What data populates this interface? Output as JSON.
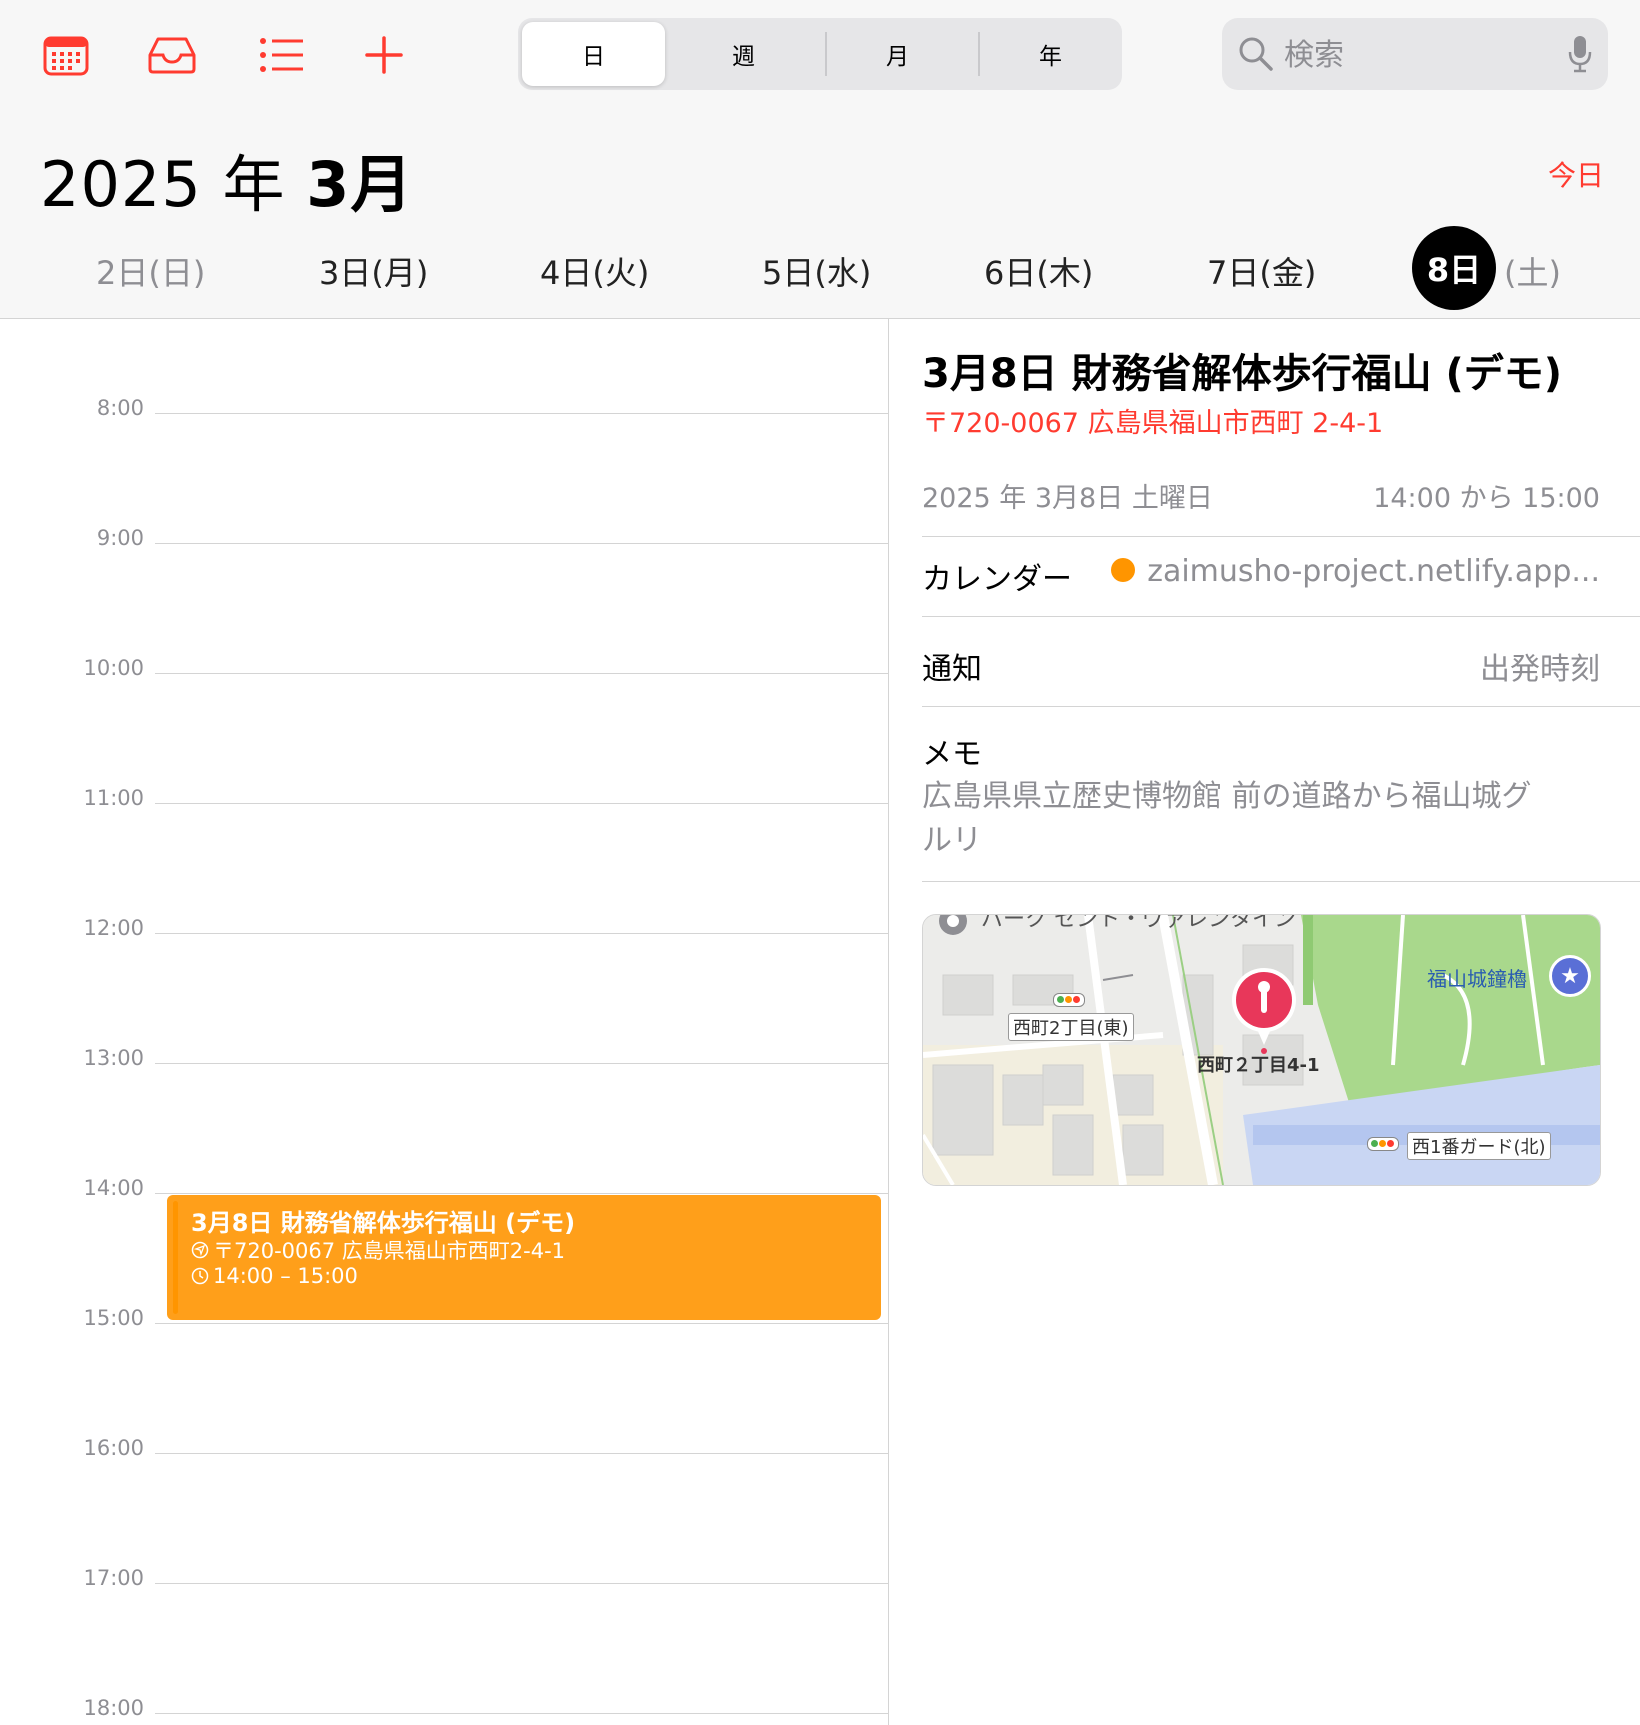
{
  "toolbar": {
    "icons": [
      "calendar-icon",
      "inbox-icon",
      "list-icon",
      "add-icon"
    ],
    "segments": [
      "日",
      "週",
      "月",
      "年"
    ],
    "active_segment": "日",
    "search_placeholder": "検索"
  },
  "header": {
    "year_label": "2025 年 ",
    "month_label": "3月",
    "today_label": "今日"
  },
  "week": {
    "days": [
      {
        "label": "2日(日)"
      },
      {
        "label": "3日(月)"
      },
      {
        "label": "4日(火)"
      },
      {
        "label": "5日(水)"
      },
      {
        "label": "6日(木)"
      },
      {
        "label": "7日(金)"
      }
    ],
    "selected_num": "8日",
    "selected_dow": "(土)"
  },
  "timeline": {
    "hours": [
      "8:00",
      "9:00",
      "10:00",
      "11:00",
      "12:00",
      "13:00",
      "14:00",
      "15:00",
      "16:00",
      "17:00",
      "18:00"
    ]
  },
  "event": {
    "title": "3月8日 財務省解体歩行福山 (デモ)",
    "address": "〒720-0067 広島県福山市西町2-4-1",
    "time": "14:00 – 15:00",
    "color": "#ff9f1a"
  },
  "detail": {
    "title": "3月8日 財務省解体歩行福山 (デモ)",
    "address": "〒720-0067 広島県福山市西町 2-4-1",
    "date": "2025 年 3月8日 土曜日",
    "time": "14:00 から 15:00",
    "calendar_label": "カレンダー",
    "calendar_value": "zaimusho-project.netlify.app...",
    "calendar_color": "#ff9500",
    "alert_label": "通知",
    "alert_value": "出発時刻",
    "memo_label": "メモ",
    "memo_text": "広島県県立歴史博物館 前の道路から福山城グルリ"
  },
  "map": {
    "labels": {
      "park": "パーク セント・ヴァレンタイン",
      "bus_stop_1": "西町2丁目(東)",
      "pin_label": "西町２丁目4-1",
      "landmark": "福山城鐘櫓",
      "bus_stop_2": "西1番ガード(北)"
    }
  }
}
